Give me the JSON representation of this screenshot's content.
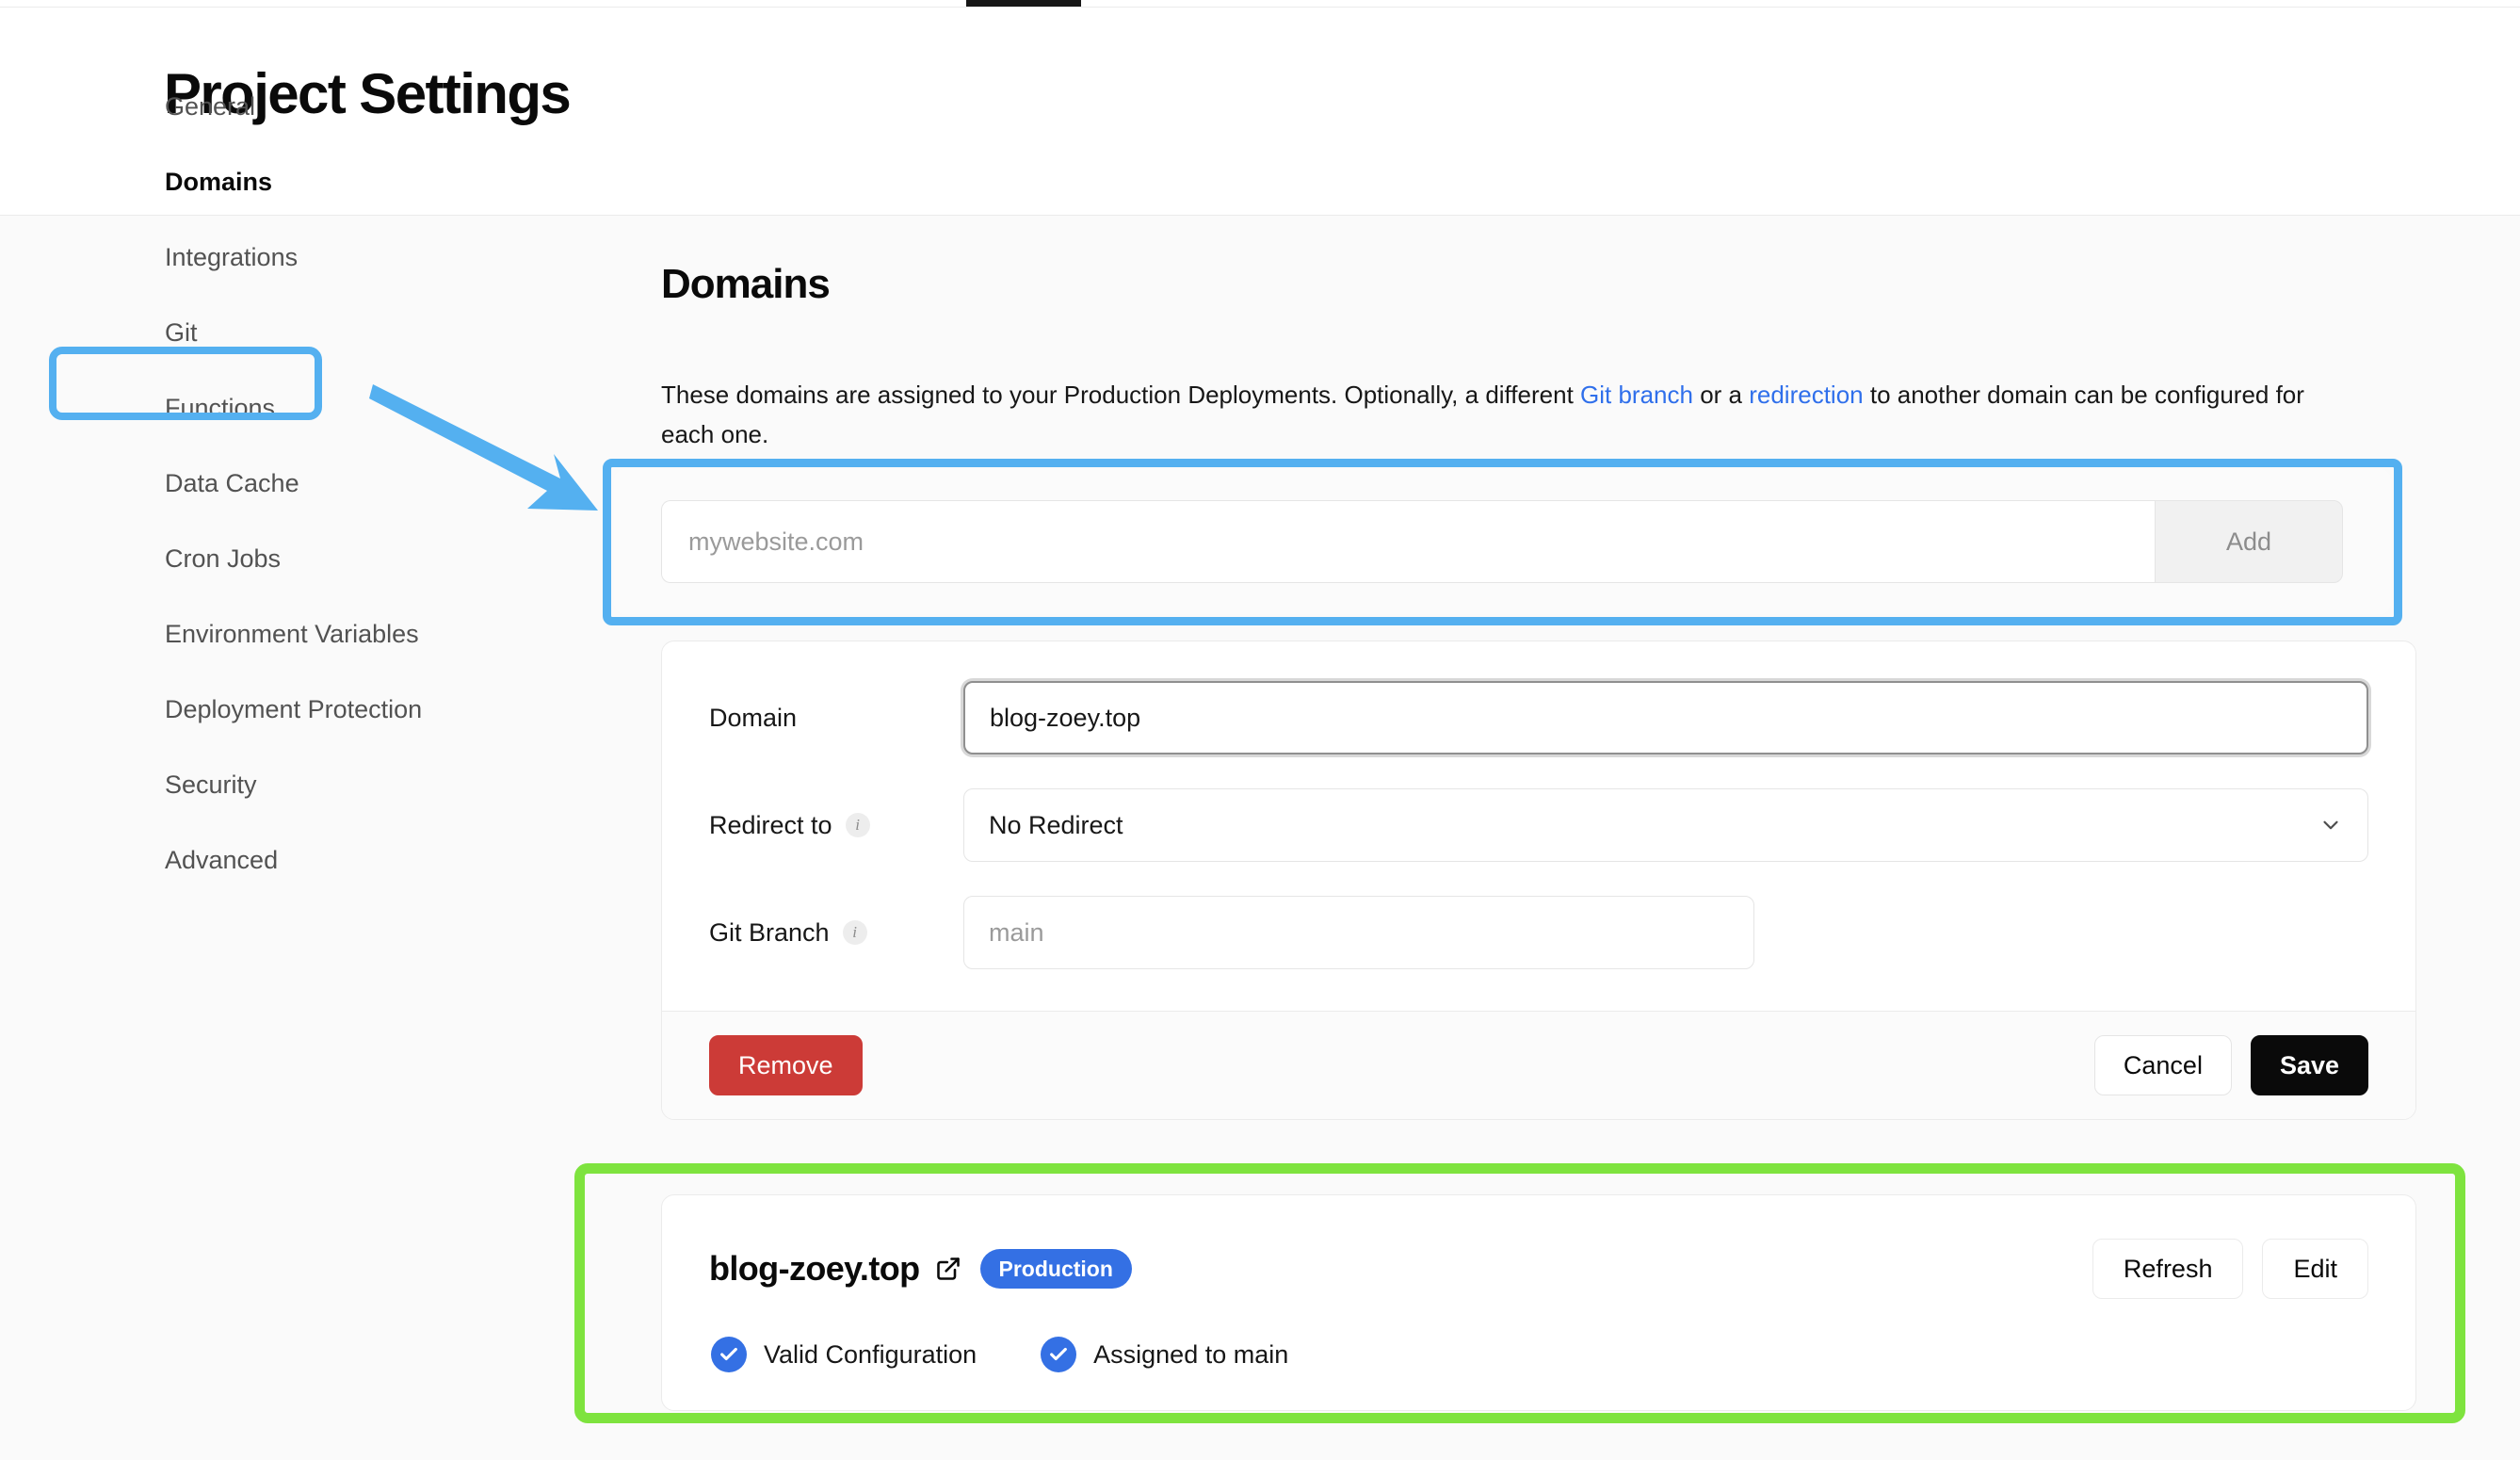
{
  "header": {
    "title": "Project Settings"
  },
  "sidebar": {
    "items": [
      {
        "label": "General",
        "active": false
      },
      {
        "label": "Domains",
        "active": true
      },
      {
        "label": "Integrations",
        "active": false
      },
      {
        "label": "Git",
        "active": false
      },
      {
        "label": "Functions",
        "active": false
      },
      {
        "label": "Data Cache",
        "active": false
      },
      {
        "label": "Cron Jobs",
        "active": false
      },
      {
        "label": "Environment Variables",
        "active": false
      },
      {
        "label": "Deployment Protection",
        "active": false
      },
      {
        "label": "Security",
        "active": false
      },
      {
        "label": "Advanced",
        "active": false
      }
    ]
  },
  "main": {
    "section_title": "Domains",
    "description": {
      "part1": "These domains are assigned to your Production Deployments. Optionally, a different ",
      "link1": "Git branch",
      "part2": " or a ",
      "link2": "redirection",
      "part3": " to another domain can be configured for each one."
    },
    "add_domain": {
      "input_value": "",
      "input_placeholder": "mywebsite.com",
      "button_label": "Add"
    },
    "edit_form": {
      "domain_label": "Domain",
      "domain_value": "blog-zoey.top",
      "redirect_label": "Redirect to",
      "redirect_value": "No Redirect",
      "redirect_info_icon": "info-icon",
      "git_branch_label": "Git Branch",
      "git_branch_value": "",
      "git_branch_placeholder": "main",
      "git_branch_info_icon": "info-icon",
      "chevron_icon": "chevron-down-icon",
      "remove_label": "Remove",
      "cancel_label": "Cancel",
      "save_label": "Save"
    },
    "domain_status": {
      "domain": "blog-zoey.top",
      "external_link_icon": "external-link-icon",
      "environment_badge": "Production",
      "refresh_label": "Refresh",
      "edit_label": "Edit",
      "checks": [
        {
          "icon": "check-icon",
          "label": "Valid Configuration"
        },
        {
          "icon": "check-icon",
          "label": "Assigned to main"
        }
      ]
    }
  },
  "colors": {
    "annotation_blue": "#54b0f0",
    "annotation_green": "#7ee33e",
    "link_blue": "#2f6feb",
    "badge_blue": "#3470e4",
    "danger_red": "#cc3b37",
    "primary_black": "#0a0a0a"
  }
}
